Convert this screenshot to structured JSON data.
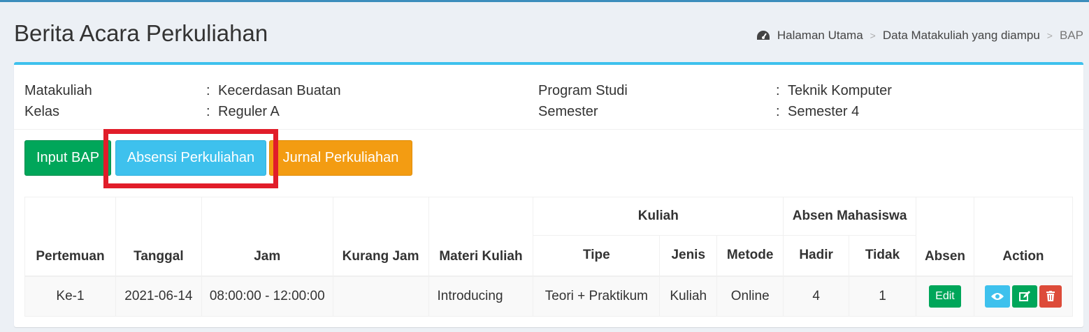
{
  "page": {
    "title": "Berita Acara Perkuliahan"
  },
  "breadcrumb": {
    "home": "Halaman Utama",
    "middle": "Data Matakuliah yang diampu",
    "current": "BAP"
  },
  "info": {
    "matakuliah_label": "Matakuliah",
    "matakuliah_value": "Kecerdasan Buatan",
    "kelas_label": "Kelas",
    "kelas_value": "Reguler A",
    "prodi_label": "Program Studi",
    "prodi_value": "Teknik Komputer",
    "semester_label": "Semester",
    "semester_value": "Semester 4",
    "colon": ":"
  },
  "buttons": {
    "input_bap": "Input BAP",
    "absensi": "Absensi Perkuliahan",
    "jurnal": "Jurnal Perkuliahan"
  },
  "table": {
    "headers": {
      "pertemuan": "Pertemuan",
      "tanggal": "Tanggal",
      "jam": "Jam",
      "kurang_jam": "Kurang Jam",
      "materi": "Materi Kuliah",
      "kuliah": "Kuliah",
      "tipe": "Tipe",
      "jenis": "Jenis",
      "metode": "Metode",
      "absen_mhs": "Absen Mahasiswa",
      "hadir": "Hadir",
      "tidak": "Tidak",
      "absen": "Absen",
      "action": "Action"
    },
    "rows": [
      {
        "pertemuan": "Ke-1",
        "tanggal": "2021-06-14",
        "jam": "08:00:00 - 12:00:00",
        "kurang_jam": "",
        "materi": "Introducing",
        "tipe": "Teori + Praktikum",
        "jenis": "Kuliah",
        "metode": "Online",
        "hadir": "4",
        "tidak": "1",
        "absen_button": "Edit"
      }
    ]
  },
  "colors": {
    "header_border": "#3c8dbc",
    "box_top": "#3ec1ed",
    "success": "#00a65a",
    "info": "#3ec1ed",
    "warning": "#f39c12",
    "danger": "#dd4b39",
    "highlight": "#e11d2a"
  },
  "icons": {
    "breadcrumb_home": "dashboard-icon",
    "view": "eye-icon",
    "edit": "edit-icon",
    "delete": "trash-icon"
  }
}
